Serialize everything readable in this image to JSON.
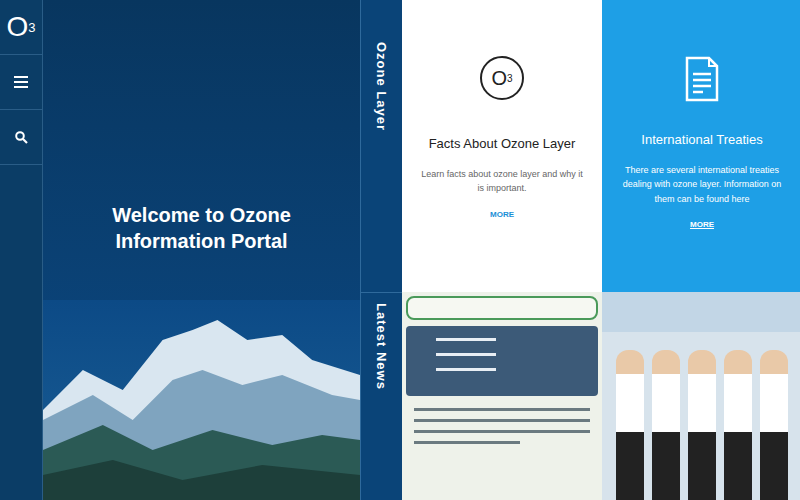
{
  "logo": {
    "base": "O",
    "sub": "3"
  },
  "hero": {
    "title": "Welcome to Ozone Information Portal"
  },
  "side_tabs": [
    {
      "label": "Ozone Layer"
    },
    {
      "label": "Latest News"
    }
  ],
  "cards": [
    {
      "kind": "light",
      "badge": {
        "base": "O",
        "sub": "3"
      },
      "title": "Facts About Ozone Layer",
      "text": "Learn facts about ozone layer and why it is important.",
      "link": "MORE"
    },
    {
      "kind": "blue",
      "badge": null,
      "title": "International Treaties",
      "text": "There are several international treaties dealing with ozone layer. Information on them can be found here",
      "link": "MORE"
    }
  ],
  "news": [
    {
      "kind": "poster"
    },
    {
      "kind": "photo"
    }
  ]
}
